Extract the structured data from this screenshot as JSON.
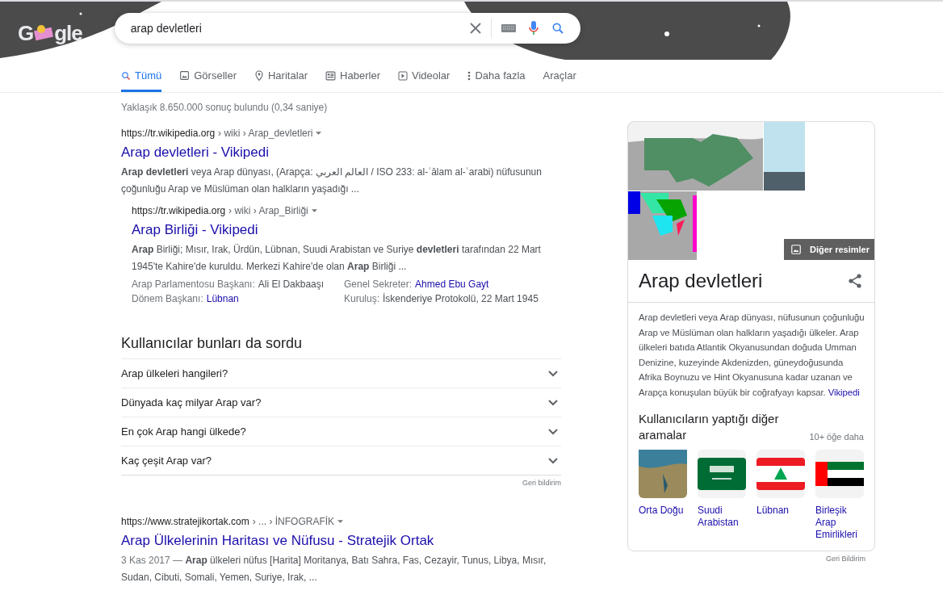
{
  "logo": {
    "left": "G",
    "right": "gle"
  },
  "search": {
    "value": "arap devletleri"
  },
  "tabs": [
    {
      "label": "Tümü",
      "kind": "search",
      "selected": true
    },
    {
      "label": "Görseller",
      "kind": "image",
      "selected": false
    },
    {
      "label": "Haritalar",
      "kind": "pin",
      "selected": false
    },
    {
      "label": "Haberler",
      "kind": "news",
      "selected": false
    },
    {
      "label": "Videolar",
      "kind": "play",
      "selected": false
    },
    {
      "label": "Daha fazla",
      "kind": "more",
      "selected": false
    }
  ],
  "tools": "Araçlar",
  "stats": "Yaklaşık 8.650.000 sonuç bulundu (0,34 saniye)",
  "results": [
    {
      "site": "https://tr.wikipedia.org",
      "path": "› wiki › Arap_devletleri",
      "title": "Arap devletleri - Vikipedi",
      "snippet": "**Arap devletleri** veya Arap dünyası, (Arapça: العالم العربي / ISO 233: al-ʿālam al-ʿarabi) nüfusunun çoğunluğu Arap ve Müslüman olan halkların yaşadığı ...",
      "sub": {
        "site": "https://tr.wikipedia.org",
        "path": "› wiki › Arap_Birliği",
        "title": "Arap Birliği - Vikipedi",
        "snippet": "**Arap** Birliği; Mısır, Irak, Ürdün, Lübnan, Suudi Arabistan ve Suriye **devletleri** tarafından 22 Mart 1945'te Kahire'de kuruldu. Merkezi Kahire'de olan **Arap** Birliği ...",
        "facts": [
          {
            "label": "Arap Parlamentosu Başkanı:",
            "value": "Ali El Dakbaaşı",
            "kind": "text"
          },
          {
            "label": "Genel Sekreter:",
            "value": "Ahmed Ebu Gayt",
            "kind": "link"
          },
          {
            "label": "Dönem Başkanı:",
            "value": "Lübnan",
            "kind": "link"
          },
          {
            "label": "Kuruluş:",
            "value": "İskenderiye Protokolü, 22 Mart 1945",
            "kind": "text"
          }
        ]
      }
    }
  ],
  "questions": {
    "title": "Kullanıcılar bunları da sordu",
    "items": [
      {
        "text": "Arap ülkeleri hangileri?",
        "expanded": false
      },
      {
        "text": "Dünyada kaç milyar Arap var?",
        "expanded": false
      },
      {
        "text": "En çok Arap hangi ülkede?",
        "expanded": false
      },
      {
        "text": "Kaç çeşit Arap var?",
        "expanded": false
      }
    ],
    "feedback": "Geri bildirim"
  },
  "result_last": {
    "site": "https://www.stratejikortak.com",
    "path": "› ... › İNFOGRAFİK",
    "title": "Arap Ülkelerinin Haritası ve Nüfusu - Stratejik Ortak",
    "date": "3 Kas 2017 —",
    "snippet": "**Arap** ülkeleri nüfus [Harita] Moritanya, Batı Sahra, Fas, Cezayir, Tunus, Libya, Mısır, Sudan, Cibuti, Somali, Yemen, Suriye, Irak, ..."
  },
  "panel": {
    "more_images": "Diğer resimler",
    "title": "Arap devletleri",
    "description": "Arap devletleri veya Arap dünyası, nüfusunun çoğunluğu Arap ve Müslüman olan halkların yaşadığı ülkeler. Arap ülkeleri batıda Atlantik Okyanusundan doğuda Umman Denizine, kuzeyinde Akdenizden, güneydoğusunda Afrika Boynuzu ve Hint Okyanusuna kadar uzanan ve Arapça konuşulan büyük bir coğrafyayı kapsar.",
    "source": "Vikipedi",
    "related_title": "Kullanıcıların yaptığı diğer aramalar",
    "related_more": "10+ öğe daha",
    "related": [
      {
        "label": "Orta Doğu",
        "kind": "photo"
      },
      {
        "label": "Suudi Arabistan",
        "kind": "flag-sa"
      },
      {
        "label": "Lübnan",
        "kind": "flag-lb"
      },
      {
        "label": "Birleşik Arap Emirlikleri",
        "kind": "flag-ae"
      }
    ],
    "feedback": "Geri Bildirim"
  }
}
